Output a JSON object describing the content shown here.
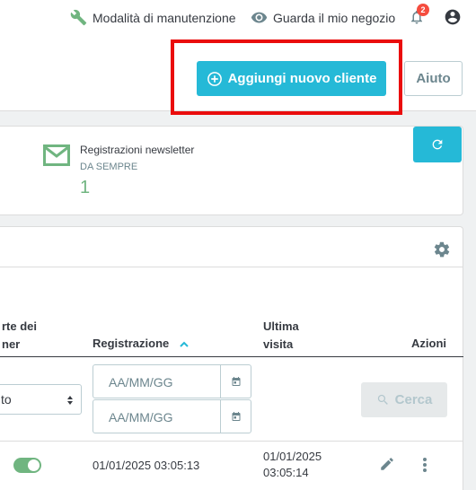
{
  "topbar": {
    "maintenance_label": "Modalità di manutenzione",
    "view_store_label": "Guarda il mio negozio",
    "notifications_count": "2"
  },
  "header": {
    "add_customer_label": "Aggiungi nuovo cliente",
    "help_label": "Aiuto"
  },
  "kpi": {
    "title": "Registrazioni newsletter",
    "subtitle": "DA SEMPRE",
    "value": "1"
  },
  "table": {
    "columns": {
      "partner_line1": "rte dei",
      "partner_line2": "ner",
      "registration": "Registrazione",
      "last_visit_line1": "Ultima",
      "last_visit_line2": "visita",
      "actions": "Azioni"
    },
    "filters": {
      "partner_select_value": "to",
      "date_from_placeholder": "AA/MM/GG",
      "date_to_placeholder": "AA/MM/GG",
      "search_label": "Cerca"
    },
    "rows": [
      {
        "registration": "01/01/2025 03:05:13",
        "last_visit_line1": "01/01/2025",
        "last_visit_line2": "03:05:14",
        "partner_enabled": true
      }
    ]
  },
  "colors": {
    "primary": "#25b9d7",
    "success": "#70b580",
    "highlight": "#ea0d0d",
    "badge": "#f54c3e"
  }
}
